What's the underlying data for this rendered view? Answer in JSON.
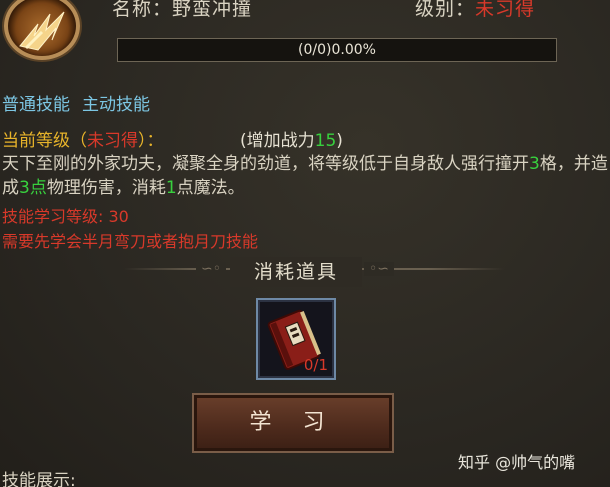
{
  "skill": {
    "name_label": "名称：",
    "name_value": "野蛮冲撞",
    "level_label": "级别：",
    "level_value": "未习得",
    "progress_text": "(0/0)0.00%",
    "progress_fraction": 0,
    "tags": [
      "普通技能",
      "主动技能"
    ],
    "current_level_prefix": "当前等级（",
    "current_level_value": "未习得",
    "current_level_suffix": "）：",
    "power_prefix": "(增加战力",
    "power_value": "15",
    "power_suffix": ")",
    "desc_part1": "天下至刚的外家功夫，凝聚全身的劲道，将等级低于自身敌人强行撞开",
    "desc_num1": "3",
    "desc_part2": "格，并造成",
    "desc_num2": "3点",
    "desc_part3": "物理伤害，消耗",
    "desc_num3": "1",
    "desc_part4": "点魔法。",
    "requirement_level": "技能学习等级: 30",
    "requirement_prereq": "需要先学会半月弯刀或者抱月刀技能"
  },
  "consume": {
    "title": "消耗道具",
    "item_icon": "red-skill-book-icon",
    "item_count": "0/1"
  },
  "learn_button": "学 习",
  "watermark": "知乎 @帅气的嘴",
  "skill_show_label": "技能展示:",
  "colors": {
    "red": "#d8392a",
    "green": "#38d13e",
    "gold": "#e8b42a",
    "cyan": "#7cc6e3"
  }
}
